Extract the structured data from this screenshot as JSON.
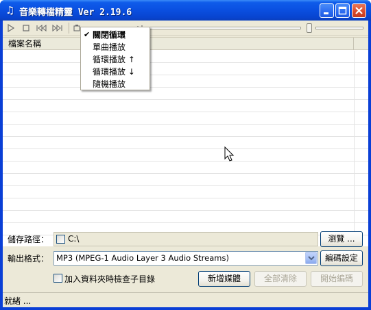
{
  "window": {
    "title": "音樂轉檔精靈 Ver 2.19.6",
    "icon": "music-note-icon"
  },
  "toolbar": {
    "icons": [
      "play-icon",
      "stop-icon",
      "prev-icon",
      "next-icon",
      "settings-icon",
      "spectrum-icon"
    ]
  },
  "list": {
    "column_name": "檔案名稱"
  },
  "menu": {
    "items": [
      {
        "label": "關閉循環",
        "checked": true
      },
      {
        "label": "單曲播放",
        "checked": false
      },
      {
        "label": "循環播放 ↑",
        "checked": false
      },
      {
        "label": "循環播放 ↓",
        "checked": false
      },
      {
        "label": "隨機播放",
        "checked": false
      }
    ]
  },
  "form": {
    "save_path_label": "儲存路徑：",
    "save_path_value": "C:\\",
    "browse_button": "瀏覽 ...",
    "output_format_label": "輸出格式：",
    "output_format_value": "MP3 (MPEG-1 Audio Layer 3 Audio Streams)",
    "encode_settings_button": "編碼設定",
    "include_subfolders_label": "加入資料夾時檢查子目錄",
    "add_media_button": "新增媒體",
    "clear_all_button": "全部清除",
    "start_encode_button": "開始編碼"
  },
  "status": {
    "text": "就緒 ..."
  },
  "colors": {
    "titlebar": "#0a4fe0",
    "close_button": "#d9482a",
    "face": "#ece9d8"
  }
}
